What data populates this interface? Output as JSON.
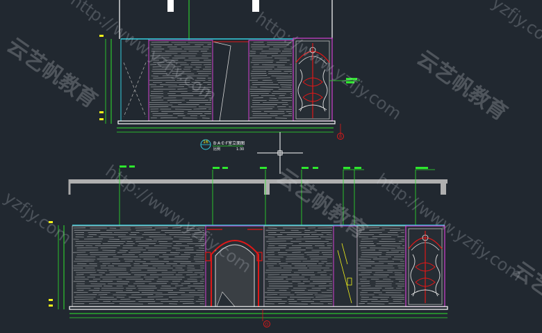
{
  "drawing": {
    "elevation_top": {
      "number": "16",
      "title": "B·A·E·F室立面图",
      "scale_label": "比例",
      "scale": "1:30"
    },
    "section_markers": {
      "top": "B",
      "bottom": "D"
    }
  },
  "watermarks": {
    "brand": "云艺帆教育",
    "url": "http://www.yzfjy.com",
    "domain": "yzfjy.com"
  },
  "colors": {
    "background": "#212830",
    "outline": "#ffffff",
    "cyan": "#35d0e0",
    "magenta": "#d040d0",
    "green": "#2ee82e",
    "yellow": "#f2f21a",
    "red": "#e01818",
    "gray": "#a8a8a8"
  },
  "icons": {
    "crosshair": "crosshair-cursor-icon",
    "elevation_marker": "elevation-marker-icon"
  }
}
